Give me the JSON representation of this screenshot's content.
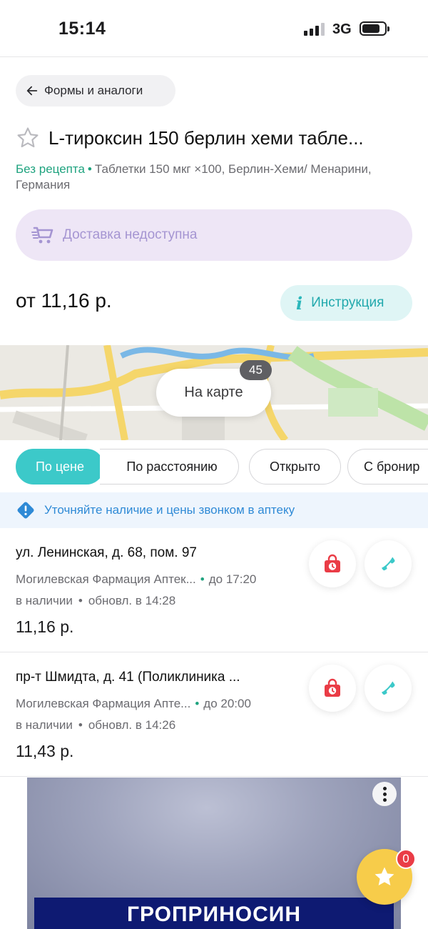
{
  "status_bar": {
    "time": "15:14",
    "network": "3G"
  },
  "back": {
    "label": "Формы и аналоги"
  },
  "product": {
    "title": "L-тироксин 150 берлин хеми табле...",
    "prescription": "Без рецепта",
    "details": "Таблетки 150 мкг ×100, Берлин-Хеми/ Менарини, Германия"
  },
  "delivery": {
    "label": "Доставка недоступна"
  },
  "price": {
    "from": "от 11,16 р."
  },
  "instruction": {
    "label": "Инструкция"
  },
  "map": {
    "button_label": "На карте",
    "count": "45"
  },
  "filters": [
    "По цене",
    "По расстоянию",
    "Открыто",
    "С бронир"
  ],
  "active_filter": "По цене",
  "banner": {
    "text": "Уточняйте наличие и цены звонком в аптеку"
  },
  "pharmacies": [
    {
      "address": "ул. Ленинская, д. 68, пом. 97",
      "name": "Могилевская Фармация Аптек...",
      "hours": "до 17:20",
      "stock": "в наличии",
      "updated": "обновл. в 14:28",
      "price": "11,16 р."
    },
    {
      "address": "пр-т Шмидта, д. 41 (Поликлиника ...",
      "name": "Могилевская Фармация Апте...",
      "hours": "до 20:00",
      "stock": "в наличии",
      "updated": "обновл. в 14:26",
      "price": "11,43 р."
    }
  ],
  "ad": {
    "text": "ГРОПРИНОСИН"
  },
  "favorites": {
    "count": "0"
  },
  "colors": {
    "accent": "#3cc9c9",
    "green": "#1fa37f",
    "delivery_bg": "#eee6f6",
    "reserve_red": "#ea3c46",
    "fab": "#f7cc4a"
  }
}
